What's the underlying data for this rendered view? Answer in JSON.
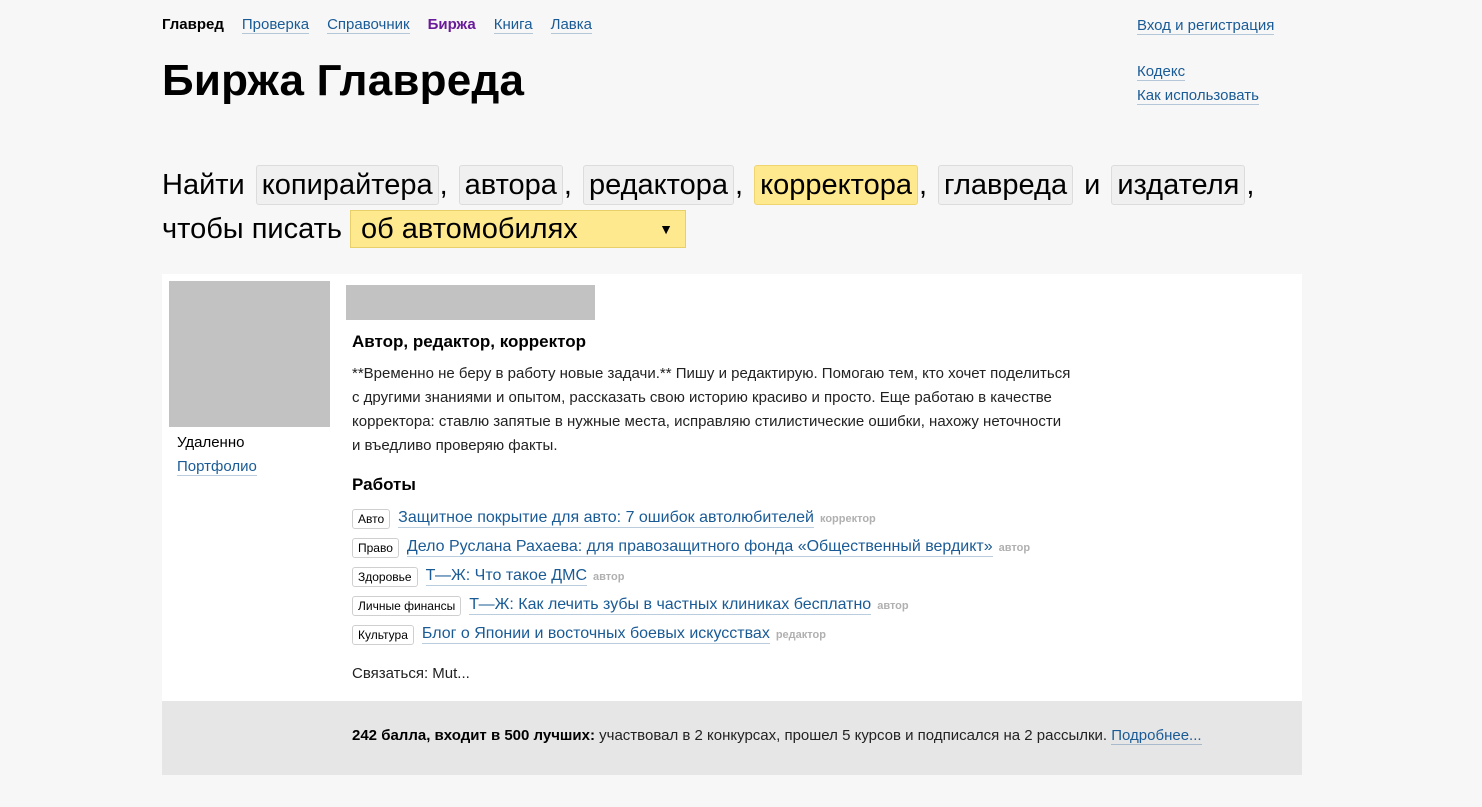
{
  "nav": {
    "items": [
      {
        "label": "Главред",
        "state": "current"
      },
      {
        "label": "Проверка",
        "state": "link"
      },
      {
        "label": "Справочник",
        "state": "link"
      },
      {
        "label": "Биржа",
        "state": "active"
      },
      {
        "label": "Книга",
        "state": "link"
      },
      {
        "label": "Лавка",
        "state": "link"
      }
    ],
    "login": "Вход и регистрация",
    "side": [
      "Кодекс",
      "Как использовать"
    ]
  },
  "title": "Биржа Главреда",
  "finder": {
    "prefix": "Найти",
    "roles": [
      {
        "label": "копирайтера",
        "selected": false
      },
      {
        "label": "автора",
        "selected": false
      },
      {
        "label": "редактора",
        "selected": false
      },
      {
        "label": "корректора",
        "selected": true
      },
      {
        "label": "главреда",
        "selected": false
      },
      {
        "label": "издателя",
        "selected": false
      }
    ],
    "conj": "и",
    "comma": ",",
    "second_line": "чтобы писать",
    "topic": "об автомобилях",
    "topic_arrow": "▼"
  },
  "profile": {
    "location": "Удаленно",
    "portfolio": "Портфолио",
    "role": "Автор, редактор, корректор",
    "about": "**Временно не беру в работу новые задачи.** Пишу и редактирую. Помогаю тем, кто хочет поделиться с другими знаниями и опытом, рассказать свою историю красиво и просто. Еще работаю в качестве корректора: ставлю запятые в нужные места, исправляю стилистические ошибки, нахожу неточности и въедливо проверяю факты.",
    "works_title": "Работы",
    "works": [
      {
        "tag": "Авто",
        "title": "Защитное покрытие для авто: 7 ошибок автолюбителей",
        "role": "корректор"
      },
      {
        "tag": "Право",
        "title": "Дело Руслана Рахаева: для правозащитного фонда «Общественный вердикт»",
        "role": "автор"
      },
      {
        "tag": "Здоровье",
        "title": "Т—Ж: Что такое ДМС",
        "role": "автор"
      },
      {
        "tag": "Личные финансы",
        "title": "Т—Ж: Как лечить зубы в частных клиниках бесплатно",
        "role": "автор"
      },
      {
        "tag": "Культура",
        "title": "Блог о Японии и восточных боевых искусствах",
        "role": "редактор"
      }
    ],
    "contact": "Связаться: Mut..."
  },
  "footer": {
    "score": "242 балла, входит в 500 лучших:",
    "details": " участвовал в 2 конкурсах, прошел 5 курсов и подписался на 2 рассылки. ",
    "more": "Подробнее..."
  }
}
